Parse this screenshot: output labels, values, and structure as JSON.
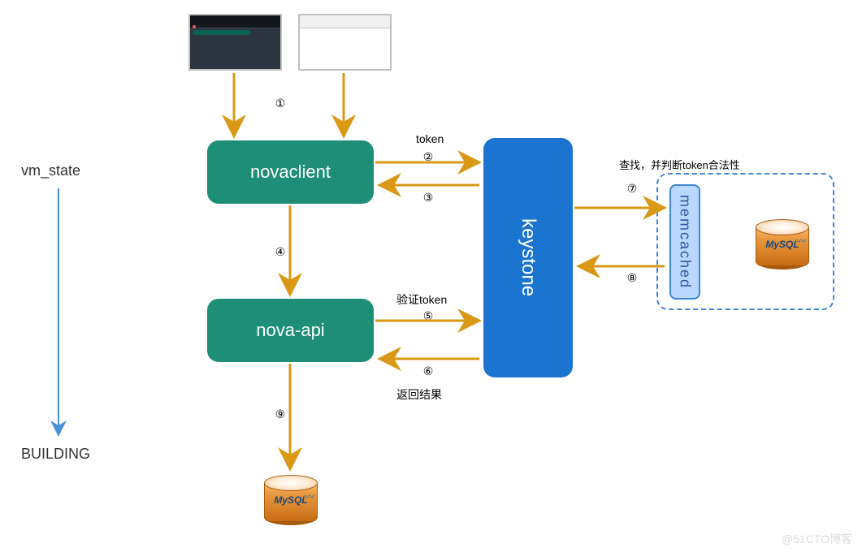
{
  "side": {
    "top": "vm_state",
    "bottom": "BUILDING"
  },
  "boxes": {
    "novaclient": "novaclient",
    "novaapi": "nova-api",
    "keystone": "keystone",
    "memcached": "memcached"
  },
  "labels": {
    "token": "token",
    "verify_token": "验证token",
    "return_result": "返回结果",
    "lookup": "查找，并判断token合法性"
  },
  "numbers": {
    "n1": "①",
    "n2": "②",
    "n3": "③",
    "n4": "④",
    "n5": "⑤",
    "n6": "⑥",
    "n7": "⑦",
    "n8": "⑧",
    "n9": "⑨"
  },
  "db_label": "MySQL",
  "watermark": "@51CTO博客",
  "colors": {
    "arrow": "#d99815",
    "side_arrow": "#4a90d9"
  }
}
